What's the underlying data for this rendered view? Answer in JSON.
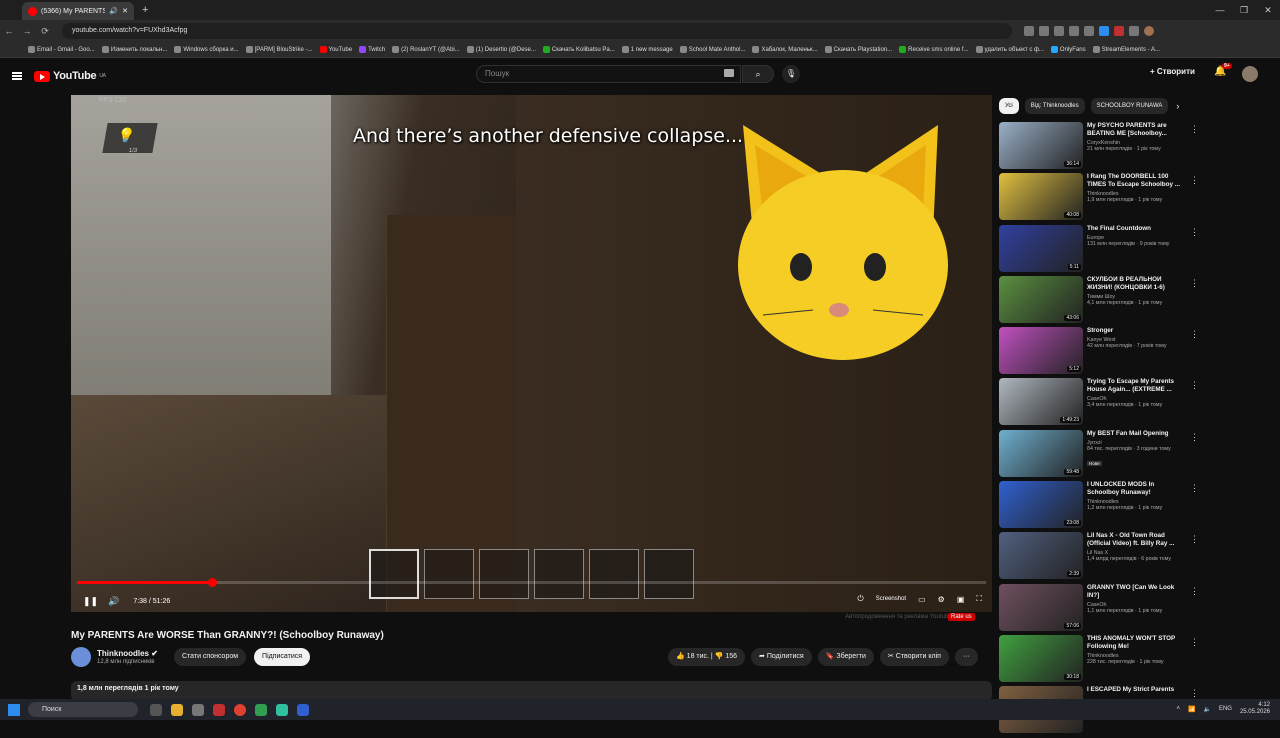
{
  "browser": {
    "tab_title": "(5366) My PARENTS Are W",
    "new_tab": "+",
    "url": "youtube.com/watch?v=FUXhd3Acfpg",
    "window_controls": [
      "—",
      "❐",
      "✕"
    ],
    "bookmarks": [
      "Email - Gmail - Goo...",
      "Изменить локальн...",
      "Windows сборка и...",
      "[PARM] BlouStrike -...",
      "YouTube",
      "Twitch",
      "(2) RoslanYT (@Abi...",
      "(1) Desertio (@Dese...",
      "Скачать Kolibatsu Pa...",
      "1 new message",
      "School Mate Anthol...",
      "Хабалок, Маленьк...",
      "Скачать Playstation...",
      "Receive sms online f...",
      "удалить объект с ф...",
      "OnlyFans",
      "StreamElements - A..."
    ]
  },
  "youtube": {
    "logo": "YouTube",
    "logo_country": "UA",
    "search_placeholder": "Пошук",
    "create_label": "+ Створити",
    "notif_count": "9+"
  },
  "player": {
    "fps": "FPS 120",
    "bulb_count": "1/3",
    "subtitle": "And there’s another defensive collapse...",
    "time": "7:38 / 51:26",
    "progress": 0.148,
    "screenshot_label": "Screenshot",
    "ad_note": "Автопродовження та реклама Youtube",
    "rate_us": "Rate us"
  },
  "video": {
    "title": "My PARENTS Are WORSE Than GRANNY?! (Schoolboy Runaway)",
    "channel": "Thinknoodles",
    "subscribers": "12,8 млн підписників",
    "sponsor_label": "Стати спонсором",
    "subscribe_label": "Підписатися",
    "likes": "18 тис.",
    "dislikes": "156",
    "share_label": "Поділитися",
    "save_label": "Зберегти",
    "clip_label": "Створити кліп",
    "more_label": "···",
    "views": "1,8 млн переглядів  1 рік тому"
  },
  "sidebar": {
    "chips": [
      "Усі",
      "Від: Thinknoodles",
      "SCHOOLBOY RUNAWA"
    ],
    "recs": [
      {
        "title": "My PSYCHO PARENTS are BEATING ME [Schoolboy...",
        "channel": "CoryxKenshin",
        "meta": "21 млн переглядів · 1 рік тому",
        "dur": "36:14",
        "color": "#9ab0c8"
      },
      {
        "title": "I Rang The DOORBELL 100 TIMES To Escape Schoolboy ...",
        "channel": "Thinknoodles",
        "meta": "1,9 млн переглядів · 1 рік тому",
        "dur": "40:08",
        "color": "#e0c040"
      },
      {
        "title": "The Final Countdown",
        "channel": "Europe",
        "meta": "131 млн переглядів · 9 років тому",
        "dur": "5:11",
        "color": "#3040a0"
      },
      {
        "title": "СКУЛБОЙ В РЕАЛЬНОЙ ЖИЗНИ! (КОНЦОВКИ 1-6)",
        "channel": "Тимми Шоу",
        "meta": "4,1 млн переглядів · 1 рік тому",
        "dur": "43:06",
        "color": "#5a9040"
      },
      {
        "title": "Stronger",
        "channel": "Kanye West",
        "meta": "42 млн переглядів · 7 років тому",
        "dur": "5:12",
        "color": "#c050c0"
      },
      {
        "title": "Trying To Escape My Parents House Again... (EXTREME ...",
        "channel": "CaseOh",
        "meta": "3,4 млн переглядів · 1 рік тому",
        "dur": "1:49:23",
        "color": "#b0b8c0"
      },
      {
        "title": "My BEST Fan Mail Opening",
        "channel": "Jynxzi",
        "meta": "84 тис. переглядів · 3 години тому",
        "dur": "59:48",
        "color": "#6fb0d0",
        "badge": "Нове"
      },
      {
        "title": "I UNLOCKED MODS In Schoolboy Runaway!",
        "channel": "Thinknoodles",
        "meta": "1,2 млн переглядів · 1 рік тому",
        "dur": "23:08",
        "color": "#3060d0"
      },
      {
        "title": "Lil Nas X - Old Town Road (Official Video) ft. Billy Ray ...",
        "channel": "Lil Nas X",
        "meta": "1,4 млрд переглядів · 6 років тому",
        "dur": "2:39",
        "color": "#506080"
      },
      {
        "title": "GRANNY TWO [Can We Look IN?]",
        "channel": "CaseOh",
        "meta": "1,1 млн переглядів · 1 рік тому",
        "dur": "57:06",
        "color": "#705060"
      },
      {
        "title": "THIS ANOMALY WON'T STOP Following Me!",
        "channel": "Thinknoodles",
        "meta": "228 тис. переглядів · 1 рік тому",
        "dur": "30:18",
        "color": "#40a040"
      },
      {
        "title": "I ESCAPED My Strict Parents",
        "channel": "",
        "meta": "",
        "dur": "",
        "color": "#806040"
      }
    ]
  },
  "taskbar": {
    "search": "Поиск",
    "lang": "ENG",
    "time": "4:12",
    "date": "25.05.2026"
  }
}
